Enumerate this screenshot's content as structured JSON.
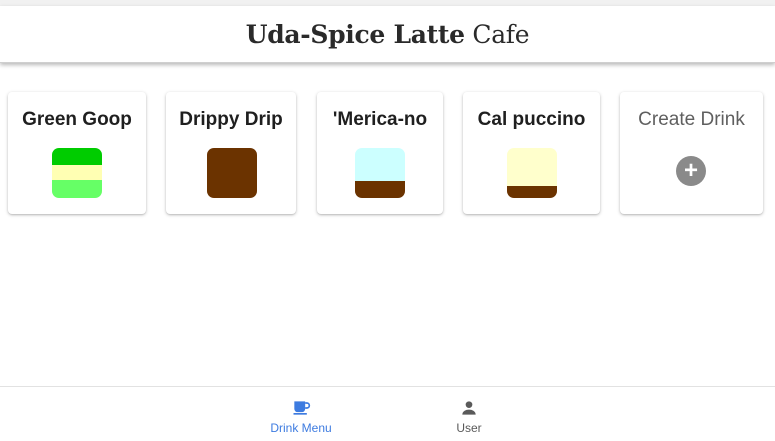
{
  "header": {
    "title_bold": "Uda-Spice Latte",
    "title_light": "Cafe"
  },
  "drinks": [
    {
      "name": "Green Goop",
      "layers": [
        {
          "color": "#00cc00",
          "fraction": 0.34
        },
        {
          "color": "#ffffb3",
          "fraction": 0.3
        },
        {
          "color": "#66ff66",
          "fraction": 0.36
        }
      ]
    },
    {
      "name": "Drippy Drip",
      "layers": [
        {
          "color": "#6b3300",
          "fraction": 1.0
        }
      ]
    },
    {
      "name": "'Merica-no",
      "layers": [
        {
          "color": "#ccffff",
          "fraction": 0.66
        },
        {
          "color": "#6b3300",
          "fraction": 0.34
        }
      ]
    },
    {
      "name": "Cal puccino",
      "layers": [
        {
          "color": "#ffffcc",
          "fraction": 0.76
        },
        {
          "color": "#6b3300",
          "fraction": 0.24
        }
      ]
    }
  ],
  "create": {
    "label": "Create Drink",
    "icon": "add-circle-icon"
  },
  "nav": [
    {
      "label": "Drink Menu",
      "icon": "coffee-cup-icon",
      "active": true,
      "color": "#3d7be0"
    },
    {
      "label": "User",
      "icon": "person-icon",
      "active": false,
      "color": "#5a5a5a"
    }
  ]
}
